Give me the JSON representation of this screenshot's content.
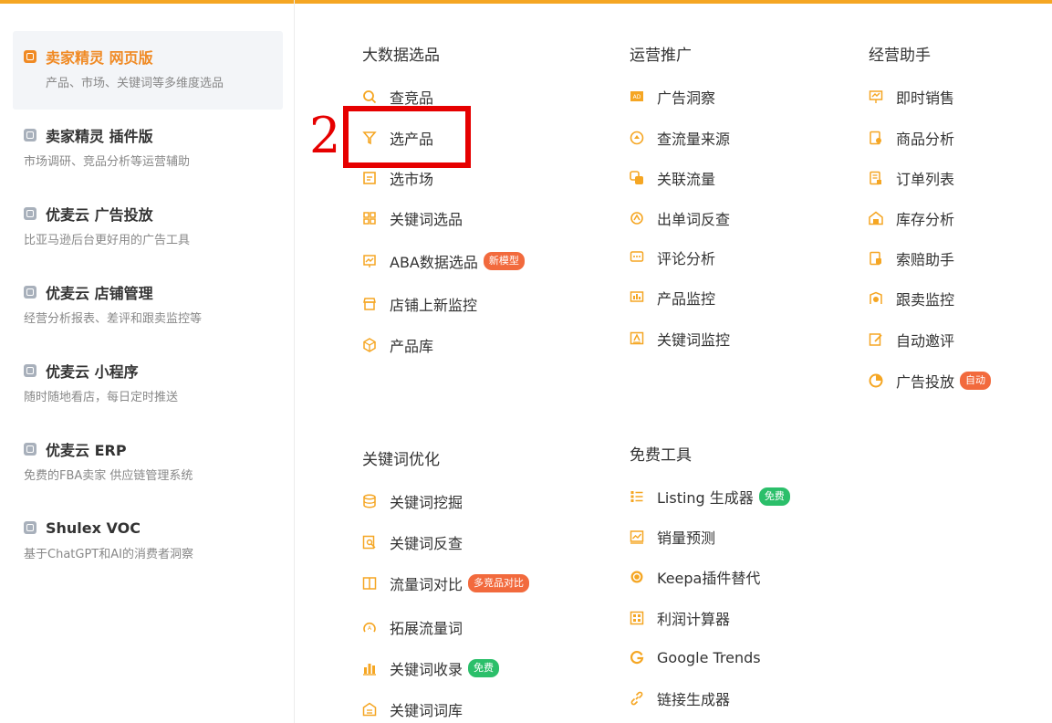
{
  "sidebar": {
    "items": [
      {
        "title": "卖家精灵 网页版",
        "desc": "产品、市场、关键词等多维度选品"
      },
      {
        "title": "卖家精灵 插件版",
        "desc": "市场调研、竞品分析等运营辅助"
      },
      {
        "title": "优麦云 广告投放",
        "desc": "比亚马逊后台更好用的广告工具"
      },
      {
        "title": "优麦云 店铺管理",
        "desc": "经营分析报表、差评和跟卖监控等"
      },
      {
        "title": "优麦云 小程序",
        "desc": "随时随地看店，每日定时推送"
      },
      {
        "title": "优麦云 ERP",
        "desc": "免费的FBA卖家 供应链管理系统"
      },
      {
        "title": "Shulex VOC",
        "desc": "基于ChatGPT和AI的消费者洞察"
      }
    ]
  },
  "columns": {
    "big_data": {
      "title": "大数据选品",
      "items": [
        "查竞品",
        "选产品",
        "选市场",
        "关键词选品",
        "ABA数据选品",
        "店铺上新监控",
        "产品库"
      ],
      "aba_badge": "新模型"
    },
    "operations": {
      "title": "运营推广",
      "items": [
        "广告洞察",
        "查流量来源",
        "关联流量",
        "出单词反查",
        "评论分析",
        "产品监控",
        "关键词监控"
      ]
    },
    "assistant": {
      "title": "经营助手",
      "items": [
        "即时销售",
        "商品分析",
        "订单列表",
        "库存分析",
        "索赔助手",
        "跟卖监控",
        "自动邀评",
        "广告投放"
      ],
      "ad_badge": "自动"
    },
    "keyword_opt": {
      "title": "关键词优化",
      "items": [
        "关键词挖掘",
        "关键词反查",
        "流量词对比",
        "拓展流量词",
        "关键词收录",
        "关键词词库"
      ],
      "compare_badge": "多竞品对比",
      "include_badge": "免费"
    },
    "free_tools": {
      "title": "免费工具",
      "items": [
        "Listing 生成器",
        "销量预测",
        "Keepa插件替代",
        "利润计算器",
        "Google Trends",
        "链接生成器"
      ],
      "listing_badge": "免费"
    }
  },
  "annotation": {
    "step": "2"
  },
  "colors": {
    "accent": "#f08a24",
    "icon": "#f5a623",
    "highlight": "#e60000",
    "badge_orange": "#f26a3d",
    "badge_green": "#2bbf6a"
  }
}
